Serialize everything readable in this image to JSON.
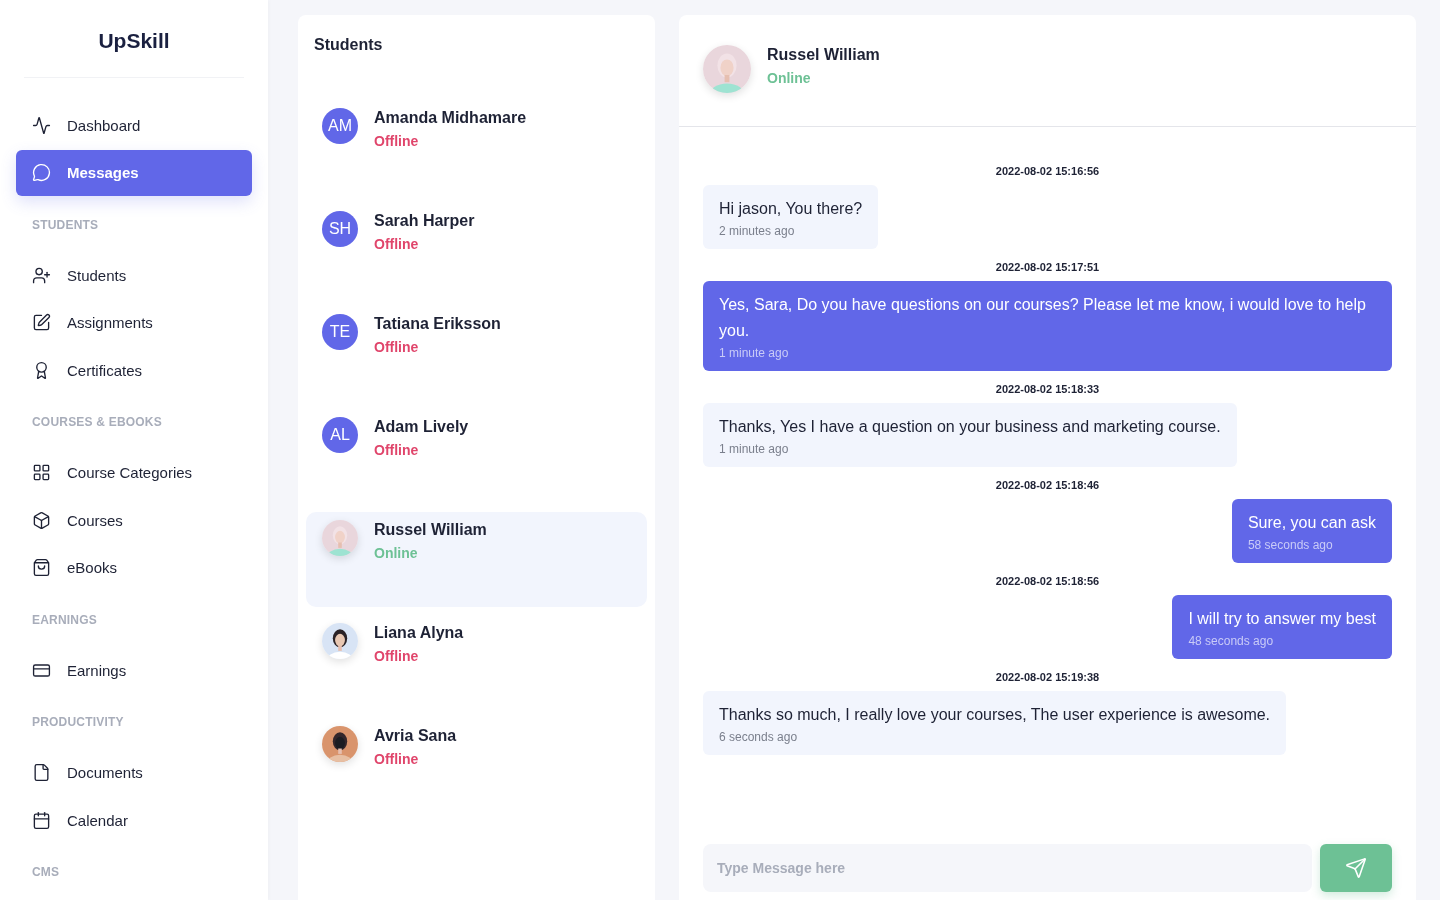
{
  "brand": "UpSkill",
  "sidebar": {
    "items": [
      {
        "kind": "nav",
        "label": "Dashboard",
        "selected": false
      },
      {
        "kind": "nav",
        "label": "Messages",
        "selected": true
      },
      {
        "kind": "section",
        "label": "STUDENTS"
      },
      {
        "kind": "nav",
        "label": "Students",
        "selected": false
      },
      {
        "kind": "nav",
        "label": "Assignments",
        "selected": false
      },
      {
        "kind": "nav",
        "label": "Certificates",
        "selected": false
      },
      {
        "kind": "section",
        "label": "COURSES & EBOOKS"
      },
      {
        "kind": "nav",
        "label": "Course Categories",
        "selected": false
      },
      {
        "kind": "nav",
        "label": "Courses",
        "selected": false
      },
      {
        "kind": "nav",
        "label": "eBooks",
        "selected": false
      },
      {
        "kind": "section",
        "label": "EARNINGS"
      },
      {
        "kind": "nav",
        "label": "Earnings",
        "selected": false
      },
      {
        "kind": "section",
        "label": "PRODUCTIVITY"
      },
      {
        "kind": "nav",
        "label": "Documents",
        "selected": false
      },
      {
        "kind": "nav",
        "label": "Calendar",
        "selected": false
      },
      {
        "kind": "section",
        "label": "CMS"
      }
    ]
  },
  "students": {
    "title": "Students",
    "items": [
      {
        "avatar": {
          "kind": "initials",
          "text": "AM"
        },
        "name": "Amanda Midhamare",
        "status": "Offline",
        "online": false,
        "selected": false
      },
      {
        "avatar": {
          "kind": "initials",
          "text": "SH"
        },
        "name": "Sarah Harper",
        "status": "Offline",
        "online": false,
        "selected": false
      },
      {
        "avatar": {
          "kind": "initials",
          "text": "TE"
        },
        "name": "Tatiana Eriksson",
        "status": "Offline",
        "online": false,
        "selected": false
      },
      {
        "avatar": {
          "kind": "initials",
          "text": "AL"
        },
        "name": "Adam Lively",
        "status": "Offline",
        "online": false,
        "selected": false
      },
      {
        "name": "Russel William",
        "status": "Online",
        "online": true,
        "selected": true
      },
      {
        "name": "Liana Alyna",
        "status": "Offline",
        "online": false,
        "selected": false
      },
      {
        "name": "Avria Sana",
        "status": "Offline",
        "online": false,
        "selected": false
      }
    ]
  },
  "chat": {
    "contact": {
      "name": "Russel William",
      "status": "Online",
      "online": true
    },
    "messages": [
      {
        "timestamp": "2022-08-02 15:16:56",
        "text": "Hi jason, You there?",
        "ago": "2 minutes ago",
        "own": false
      },
      {
        "timestamp": "2022-08-02 15:17:51",
        "text": "Yes, Sara, Do you have questions on our courses? Please let me know, i would love to help you.",
        "ago": "1 minute ago",
        "own": true
      },
      {
        "timestamp": "2022-08-02 15:18:33",
        "text": "Thanks, Yes I have a question on your business and marketing course.",
        "ago": "1 minute ago",
        "own": false
      },
      {
        "timestamp": "2022-08-02 15:18:46",
        "text": "Sure, you can ask",
        "ago": "58 seconds ago",
        "own": true
      },
      {
        "timestamp": "2022-08-02 15:18:56",
        "text": "I will try to answer my best",
        "ago": "48 seconds ago",
        "own": true
      },
      {
        "timestamp": "2022-08-02 15:19:38",
        "text": "Thanks so much, I really love your courses, The user experience is awesome.",
        "ago": "6 seconds ago",
        "own": false
      }
    ],
    "composer": {
      "placeholder": "Type Message here"
    }
  }
}
